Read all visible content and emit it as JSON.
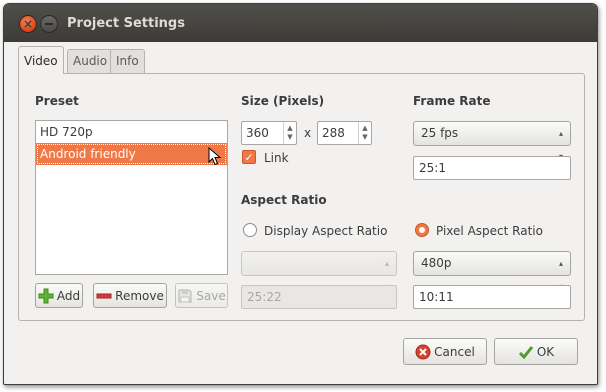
{
  "window": {
    "title": "Project Settings"
  },
  "tabs": [
    {
      "label": "Video",
      "active": true
    },
    {
      "label": "Audio",
      "active": false
    },
    {
      "label": "Info",
      "active": false
    }
  ],
  "preset": {
    "heading": "Preset",
    "items": [
      {
        "label": "HD 720p",
        "selected": false
      },
      {
        "label": "Android friendly",
        "selected": true
      }
    ],
    "add_label": "Add",
    "remove_label": "Remove",
    "save_label": "Save"
  },
  "size": {
    "heading": "Size (Pixels)",
    "width": "360",
    "separator": "x",
    "height": "288",
    "link_label": "Link",
    "link_checked": true
  },
  "frame_rate": {
    "heading": "Frame Rate",
    "selected": "25 fps",
    "ratio": "25:1"
  },
  "aspect_ratio": {
    "heading": "Aspect Ratio",
    "display_label": "Display Aspect Ratio",
    "display_value": "",
    "display_ratio": "25:22",
    "pixel_label": "Pixel Aspect Ratio",
    "pixel_selected": "480p",
    "pixel_ratio": "10:11",
    "mode": "pixel"
  },
  "footer": {
    "cancel_label": "Cancel",
    "ok_label": "OK"
  },
  "colors": {
    "accent": "#f07746",
    "titlebar": "#3c3b37"
  }
}
